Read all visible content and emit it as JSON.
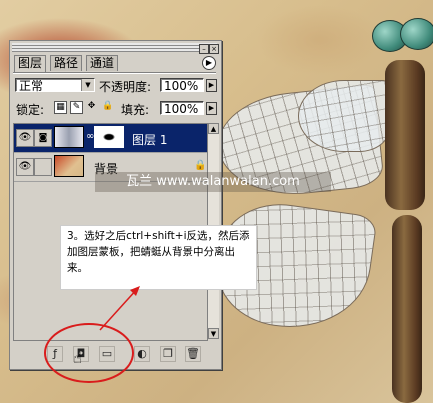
{
  "panel": {
    "tabs": [
      "图层",
      "路径",
      "通道"
    ],
    "blend_mode": "正常",
    "opacity_label": "不透明度:",
    "opacity_value": "100%",
    "lock_label": "锁定:",
    "fill_label": "填充:",
    "fill_value": "100%",
    "layers": [
      {
        "name": "图层 1",
        "selected": true,
        "has_mask": true
      },
      {
        "name": "背景",
        "selected": false,
        "locked": true
      }
    ],
    "bottom_icons": [
      "layer-style-icon",
      "add-mask-icon",
      "new-group-icon",
      "adjustment-layer-icon",
      "new-layer-icon",
      "trash-icon"
    ]
  },
  "watermark": "瓦兰 www.walanwalan.com",
  "callout": {
    "text": "3。选好之后ctrl+shift+i反选，然后添加图层蒙板，把蜻蜓从背景中分离出来。"
  },
  "colors": {
    "selection": "#0a246a",
    "annotation_red": "#d91c1c",
    "panel_bg": "#d4d0c8"
  }
}
